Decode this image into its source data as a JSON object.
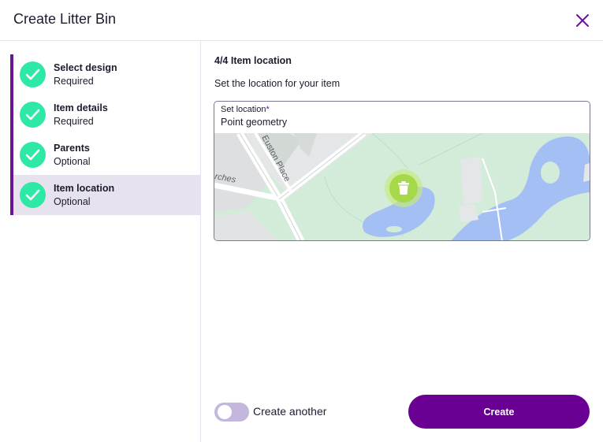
{
  "dialog": {
    "title": "Create Litter Bin"
  },
  "icons": {
    "close": "close-icon",
    "check": "check-icon",
    "delete": "trash-icon"
  },
  "colors": {
    "accent": "#6a1593",
    "button": "#6a0093",
    "step_done": "#2ee8a6",
    "active_step_bg": "#e6e3ee",
    "marker": "#a6d94a"
  },
  "steps": [
    {
      "name": "Select design",
      "status": "Required"
    },
    {
      "name": "Item details",
      "status": "Required"
    },
    {
      "name": "Parents",
      "status": "Optional"
    },
    {
      "name": "Item location",
      "status": "Optional",
      "active": true
    }
  ],
  "main": {
    "step_heading": "4/4 Item location",
    "description": "Set the location for your item",
    "location_field": {
      "label": "Set location",
      "required_mark": "*",
      "value": "Point geometry"
    },
    "map": {
      "labels": {
        "street": "Euston Place",
        "church": "rches"
      }
    }
  },
  "footer": {
    "toggle_label": "Create another",
    "toggle_on": false,
    "create_label": "Create"
  }
}
